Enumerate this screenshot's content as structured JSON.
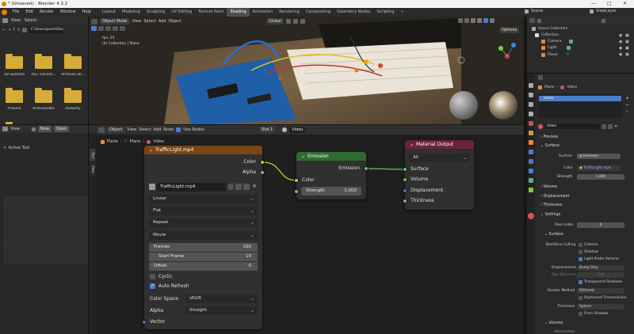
{
  "window": {
    "title": "* (Unsaved) - Blender 4.3.2",
    "controls": [
      "—",
      "□",
      "✕"
    ]
  },
  "menu": [
    "File",
    "Edit",
    "Render",
    "Window",
    "Help"
  ],
  "workspaces": [
    "Layout",
    "Modeling",
    "Sculpting",
    "UV Editing",
    "Texture Paint",
    "Shading",
    "Animation",
    "Rendering",
    "Compositing",
    "Geometry Nodes",
    "Scripting"
  ],
  "active_workspace": "Shading",
  "scene": "Scene",
  "view_layer": "ViewLayer",
  "file_browser": {
    "header": [
      "View",
      "Select"
    ],
    "path": "C:\\Users\\josm\\Doc...",
    "folders": [
      "3D Systems",
      "AEC Genera...",
      "Archivos de...",
      "Arduino",
      "ArduinoData",
      "Audacity"
    ]
  },
  "viewport_header": {
    "mode": "Object Mode",
    "menus": [
      "View",
      "Select",
      "Add",
      "Object"
    ],
    "transform": "Global",
    "options": "Options",
    "fps": "fps: 25",
    "collection": "(4) Collection | Plane"
  },
  "node_header": {
    "type": "Object",
    "menus": [
      "View",
      "Select",
      "Add",
      "Node"
    ],
    "use_nodes": "Use Nodes",
    "slot": "Slot 1",
    "material": "Video",
    "breadcrumb": [
      "Plane",
      "Plane",
      "Video"
    ]
  },
  "left_lower": {
    "menus": [
      "View"
    ],
    "new": "New",
    "open": "Open",
    "tab": "Active Tool"
  },
  "side_tabs": [
    "Tool",
    "View"
  ],
  "nodes": {
    "image": {
      "title": "TrafficLight.mp4",
      "outputs": [
        "Color",
        "Alpha"
      ],
      "image_name": "TrafficLight.mp4",
      "interpolation": "Linear",
      "projection": "Flat",
      "extension": "Repeat",
      "source": "Movie",
      "frames_label": "Frames",
      "frames_value": "100",
      "start_frame_label": "Start Frame",
      "start_frame_value": "10",
      "offset_label": "Offset",
      "offset_value": "0",
      "cyclic": "Cyclic",
      "auto_refresh": "Auto Refresh",
      "color_space_label": "Color Space",
      "color_space_value": "sRGB",
      "alpha_label": "Alpha",
      "alpha_value": "Straight",
      "vector": "Vector"
    },
    "emission": {
      "title": "Emission",
      "output": "Emission",
      "color": "Color",
      "strength_label": "Strength",
      "strength_value": "1.000"
    },
    "output": {
      "title": "Material Output",
      "target": "All",
      "inputs": [
        "Surface",
        "Volume",
        "Displacement",
        "Thickness"
      ]
    }
  },
  "outliner": {
    "root": "Scene Collection",
    "items": [
      "Collection",
      "Camera",
      "Light",
      "Plane"
    ]
  },
  "properties": {
    "object": "Plane",
    "material": "Video",
    "slot": "Video",
    "mat_name": "Video",
    "preview": "Preview",
    "surface": "Surface",
    "surface_label": "Surface",
    "surface_value": "Emission",
    "color_label": "Color",
    "color_value": "TrafficLight.mp4",
    "strength_label": "Strength",
    "strength_value": "1.000",
    "volume": "Volume",
    "displacement": "Displacement",
    "thickness": "Thickness",
    "settings": "Settings",
    "pass_index_label": "Pass Index",
    "pass_index_value": "0",
    "surface_sub": "Surface",
    "backface_culling": "Backface Culling",
    "camera": "Camera",
    "shadow": "Shadow",
    "light_probe_volume": "Light Probe Volume",
    "displacement_label": "Displacement",
    "displacement_value": "Bump Only",
    "max_distance_label": "Max Distance",
    "max_distance_value": "0 m",
    "transparent_shadows": "Transparent Shadows",
    "render_method_label": "Render Method",
    "render_method_value": "Dithered",
    "raytraced_transmission": "Raytraced Transmission",
    "thickness_label": "Thickness",
    "thickness_value": "Sphere",
    "from_shadow": "From Shadow",
    "volume_sub": "Volume",
    "intersection_label": "Intersection"
  }
}
